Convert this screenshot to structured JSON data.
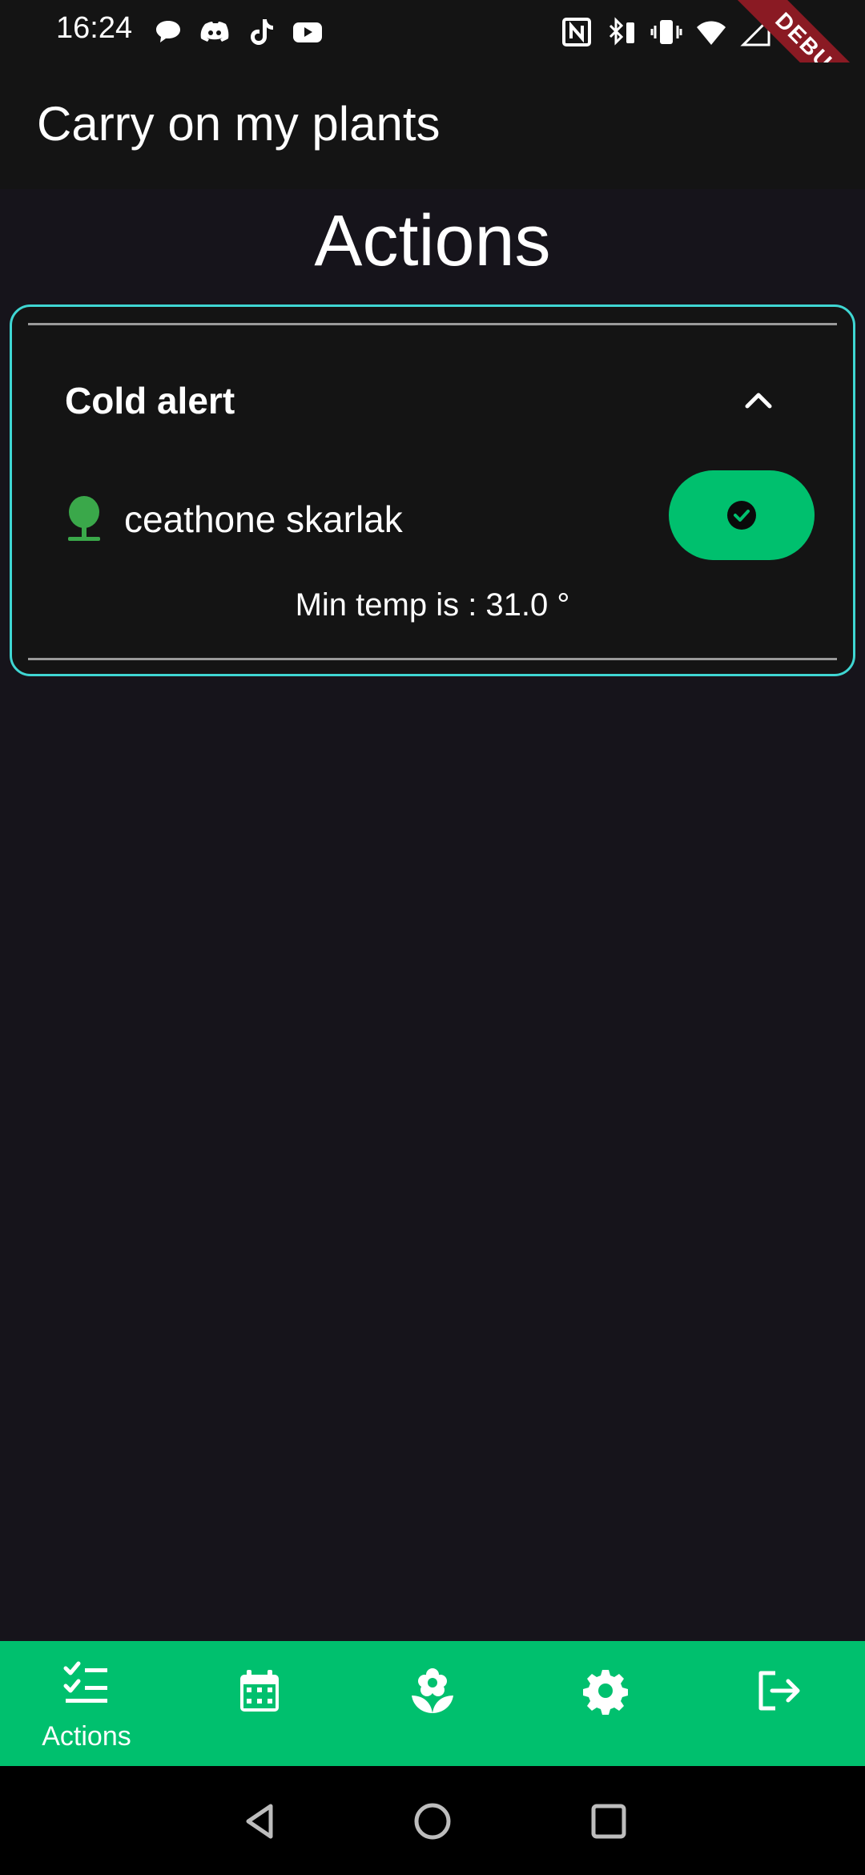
{
  "status_bar": {
    "time": "16:24",
    "left_icons": [
      "chat-bubble-icon",
      "discord-icon",
      "tiktok-icon",
      "youtube-icon"
    ],
    "right_icons": [
      "nfc-icon",
      "bluetooth-battery-icon",
      "vibrate-icon",
      "wifi-icon",
      "signal-icon",
      "battery-icon"
    ]
  },
  "debug_banner": "DEBUG",
  "app_bar": {
    "title": "Carry on my plants"
  },
  "page": {
    "heading": "Actions"
  },
  "alert_card": {
    "title": "Cold alert",
    "expanded": true,
    "plant": {
      "name": "ceathone skarlak",
      "icon": "tree-icon"
    },
    "min_temp_text": "Min temp is : 31.0 °",
    "confirm_icon": "check-circle-icon"
  },
  "bottom_nav": {
    "items": [
      {
        "icon": "checklist-icon",
        "label": "Actions",
        "active": true
      },
      {
        "icon": "calendar-icon",
        "label": "",
        "active": false
      },
      {
        "icon": "flower-icon",
        "label": "",
        "active": false
      },
      {
        "icon": "gear-icon",
        "label": "",
        "active": false
      },
      {
        "icon": "logout-icon",
        "label": "",
        "active": false
      }
    ]
  },
  "system_nav": {
    "buttons": [
      "back",
      "home",
      "recents"
    ]
  },
  "colors": {
    "background": "#16141b",
    "app_bar": "#141414",
    "accent": "#00c06e",
    "card_border": "#3fd6d3",
    "plant_icon": "#3aa84a",
    "debug_ribbon": "#8a1a23"
  }
}
